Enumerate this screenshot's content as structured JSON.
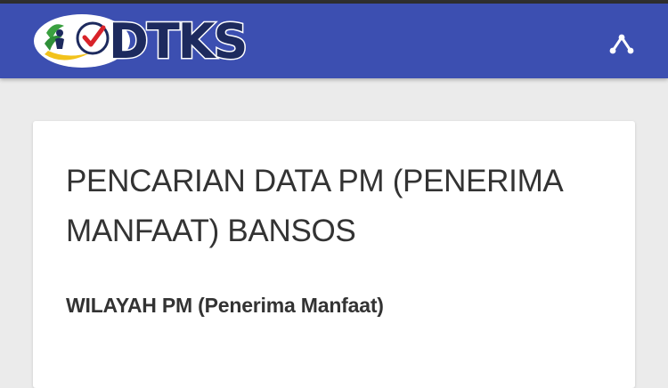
{
  "header": {
    "logo_text": "DTKS",
    "share_icon": "share-icon"
  },
  "card": {
    "title_line1": "PENCARIAN DATA PM (PENERIMA",
    "title_line2": "MANFAAT) BANSOS",
    "section_label": "WILAYAH PM (Penerima Manfaat)"
  },
  "colors": {
    "navbar": "#3c4fb1",
    "logo_text": "#1d2a5e",
    "background": "#ebebeb",
    "card": "#ffffff",
    "text": "#333333"
  }
}
